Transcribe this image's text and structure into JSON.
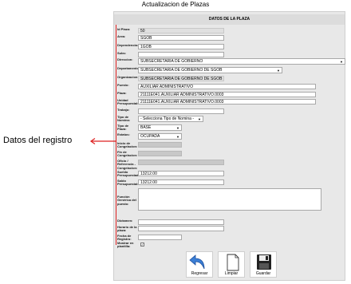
{
  "page_title": "Actualizacion de Plazas",
  "section_header": "DATOS DE LA PLAZA",
  "annotation": "Datos del registro",
  "fields": {
    "id_plaza": {
      "label": "Id Plaza:",
      "value": "50"
    },
    "area": {
      "label": "Area:",
      "value": "SGOB"
    },
    "dependencia": {
      "label": "Dependencia:",
      "value": "1GOB"
    },
    "subs": {
      "label": "Subs:",
      "value": ""
    },
    "direccion": {
      "label": "Direccion:",
      "value": "SUBSECRETARÍA DE GOBIERNO"
    },
    "departamento": {
      "label": "Departamento:",
      "value": "SUBSECRETARIA DE GOBIERNO DE SGOB"
    },
    "organizacion": {
      "label": "Organizacion:",
      "value": "SUBSECRETARIA DE GOBIERNO DE SGOB"
    },
    "puesto": {
      "label": "Puesto:",
      "value": "AUXILIAR ADMINISTRATIVO"
    },
    "plaza": {
      "label": "Plaza:",
      "value": "21111E041.AUXILIAR ADMINISTRATIVO.0003"
    },
    "unidad_presupuestal": {
      "label": "Unidad Presupuestal:",
      "value": "21111E041.AUXILIAR ADMINISTRATIVO.0003"
    },
    "trabajo": {
      "label": "Trabajo:",
      "value": ""
    },
    "tipo_nomina": {
      "label": "Tipo de Nomina:",
      "value": "- Selecciona Tipo de Nomina -"
    },
    "tipo_plaza": {
      "label": "Tipo de Plaza:",
      "value": "BASE"
    },
    "estatus": {
      "label": "Estatus:",
      "value": "OCUPADA"
    },
    "inicio_congelacion": {
      "label": "Inicio de Congelacion:",
      "value": ""
    },
    "fin_congelacion": {
      "label": "Fin de Congelacion:",
      "value": ""
    },
    "oficio_congelacion": {
      "label": "Oficio / Referencia - Congelacion:",
      "value": ""
    },
    "sueldo_presupuestado": {
      "label": "Sueldo Presupuestado:",
      "value": "13212.00"
    },
    "saldo_presupuestal": {
      "label": "Saldo Presupuestal:",
      "value": "13212.00"
    },
    "funcion_generica": {
      "label": "Función Genérica del puesto:",
      "value": ""
    },
    "dictamen": {
      "label": "Dictamen:",
      "value": ""
    },
    "horario": {
      "label": "Horario de la plaza:",
      "value": ""
    },
    "fecha_registro": {
      "label": "Fecha de Registro:",
      "value": ""
    },
    "mostrar_plantilla": {
      "label": "Mostrar en plantilla:",
      "checked": "✓"
    }
  },
  "buttons": {
    "regresar": "Regresar",
    "limpiar": "Limpiar",
    "guardar": "Guardar"
  }
}
